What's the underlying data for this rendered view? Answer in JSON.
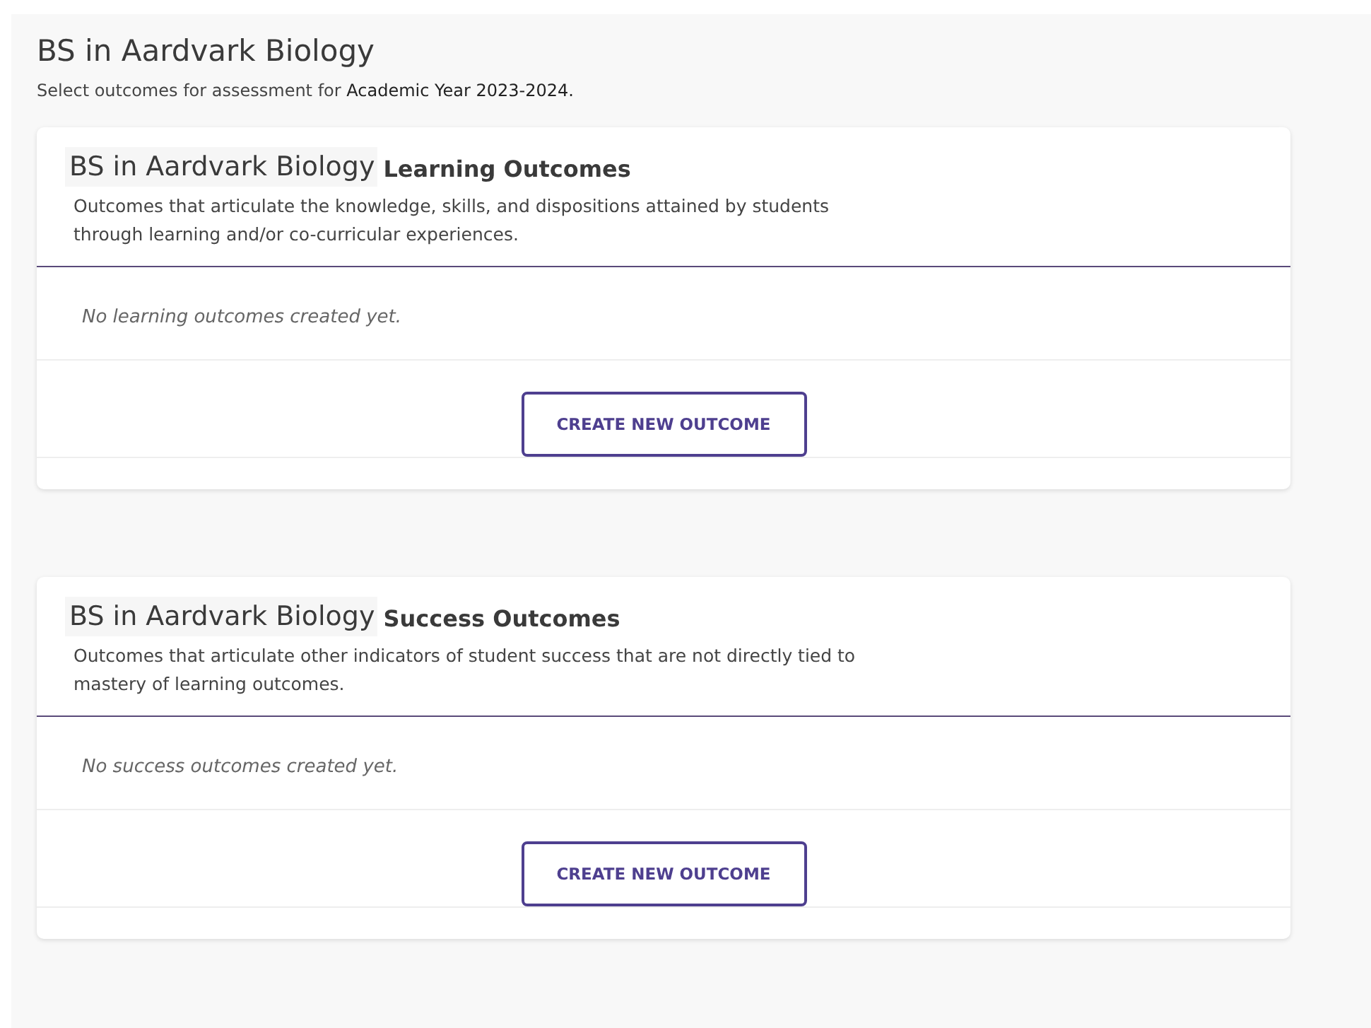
{
  "page": {
    "title": "BS in Aardvark Biology",
    "subtitle": "Select outcomes for assessment for **Academic Year 2023-2024.**"
  },
  "sections": [
    {
      "program": "BS in Aardvark Biology",
      "heading": "Learning Outcomes",
      "description": "Outcomes that articulate the knowledge, skills, and dispositions attained by students through learning and/or co-curricular experiences.",
      "empty_message": "No learning outcomes created yet.",
      "button": "CREATE NEW OUTCOME"
    },
    {
      "program": "BS in Aardvark Biology",
      "heading": "Success Outcomes",
      "description": "Outcomes that articulate other indicators of student success that are not directly tied to mastery of learning outcomes.",
      "empty_message": "No success outcomes created yet.",
      "button": "CREATE NEW OUTCOME"
    }
  ]
}
